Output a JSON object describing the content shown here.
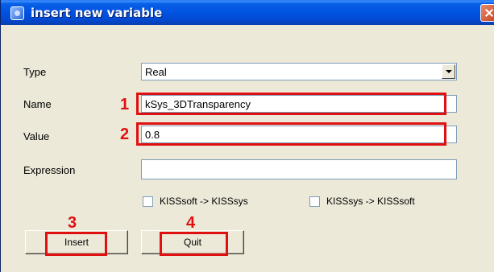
{
  "window": {
    "title": "insert new variable",
    "app_icon": "kiss-sys-icon"
  },
  "form": {
    "type": {
      "label": "Type",
      "value": "Real"
    },
    "name": {
      "label": "Name",
      "value": "kSys_3DTransparency"
    },
    "value": {
      "label": "Value",
      "value": "0.8"
    },
    "expression": {
      "label": "Expression",
      "value": ""
    }
  },
  "checkboxes": [
    {
      "label": "KISSsoft -> KISSsys",
      "checked": false
    },
    {
      "label": "KISSsys -> KISSsoft",
      "checked": false
    }
  ],
  "buttons": {
    "insert": "Insert",
    "quit": "Quit"
  },
  "callouts": [
    "1",
    "2",
    "3",
    "4"
  ],
  "colors": {
    "callout": "#e01010",
    "titlebar": "#0054e3",
    "dialog_bg": "#ece9d8"
  }
}
